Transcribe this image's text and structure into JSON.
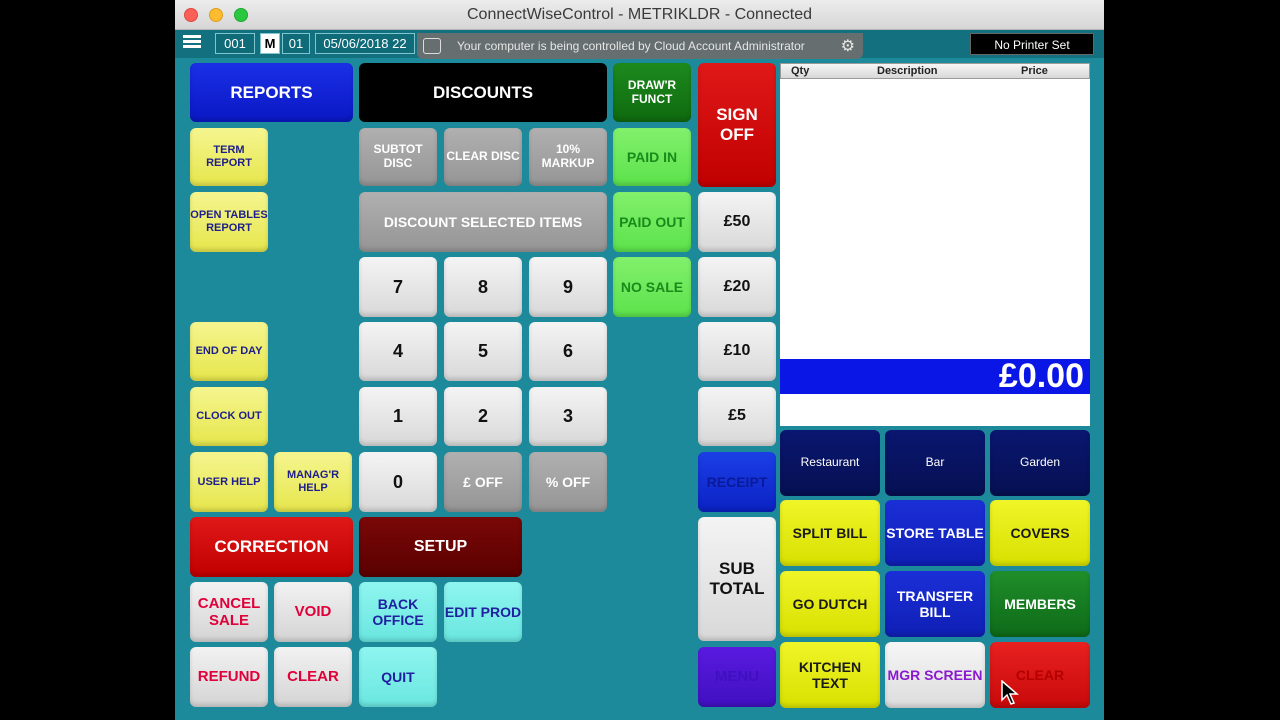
{
  "window": {
    "title": "ConnectWiseControl - METRIKLDR - Connected"
  },
  "topbar": {
    "terminal": "001",
    "mode": "M",
    "clerk": "01",
    "datetime": "05/06/2018 22",
    "printer": "No Printer Set"
  },
  "control_banner": {
    "text": "Your computer is being controlled by Cloud Account Administrator"
  },
  "left_buttons": {
    "reports": "REPORTS",
    "term_report": "TERM REPORT",
    "open_tables_report": "OPEN TABLES REPORT",
    "end_of_day": "END OF DAY",
    "clock_out": "CLOCK OUT",
    "user_help": "USER HELP",
    "managr_help": "MANAG'R HELP",
    "correction": "CORRECTION",
    "cancel_sale": "CANCEL SALE",
    "void": "VOID",
    "refund": "REFUND",
    "clear": "CLEAR"
  },
  "center_buttons": {
    "discounts": "DISCOUNTS",
    "subtot_disc": "SUBTOT DISC",
    "clear_disc": "CLEAR DISC",
    "markup": "10% MARKUP",
    "discount_selected": "DISCOUNT SELECTED ITEMS",
    "key_7": "7",
    "key_8": "8",
    "key_9": "9",
    "key_4": "4",
    "key_5": "5",
    "key_6": "6",
    "key_1": "1",
    "key_2": "2",
    "key_3": "3",
    "key_0": "0",
    "pound_off": "£ OFF",
    "percent_off": "% OFF",
    "setup": "SETUP",
    "back_office": "BACK OFFICE",
    "edit_prod": "EDIT PROD",
    "quit": "QUIT"
  },
  "drawer_column": {
    "drawr_funct": "DRAW'R FUNCT",
    "paid_in": "PAID IN",
    "paid_out": "PAID OUT",
    "no_sale": "NO SALE"
  },
  "tender_column": {
    "sign_off": "SIGN OFF",
    "fifty": "£50",
    "twenty": "£20",
    "ten": "£10",
    "five": "£5",
    "receipt": "RECEIPT",
    "sub_total": "SUB TOTAL",
    "menu": "MENU"
  },
  "receipt_panel": {
    "columns": [
      "Qty",
      "Description",
      "Price"
    ],
    "total": "£0.00"
  },
  "area_buttons": {
    "restaurant": "Restaurant",
    "bar": "Bar",
    "garden": "Garden"
  },
  "function_buttons": {
    "split_bill": "SPLIT BILL",
    "store_table": "STORE TABLE",
    "covers": "COVERS",
    "go_dutch": "GO DUTCH",
    "transfer_bill": "TRANSFER BILL",
    "members": "MEMBERS",
    "kitchen_text": "KITCHEN TEXT",
    "mgr_screen": "MGR SCREEN",
    "clear": "CLEAR"
  }
}
